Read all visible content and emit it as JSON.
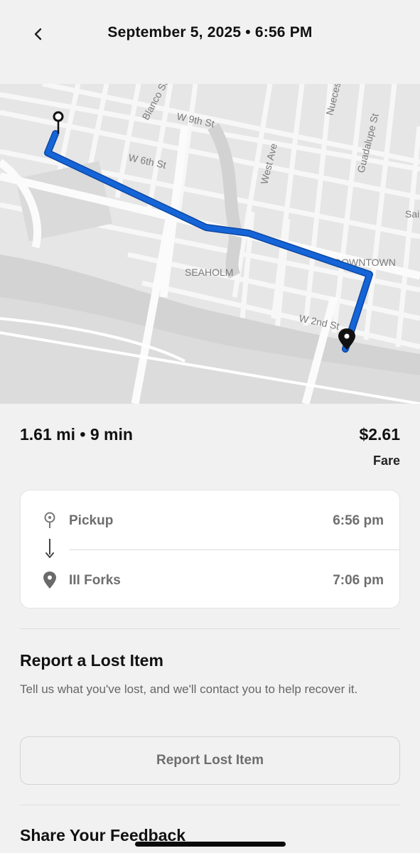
{
  "header": {
    "title": "September 5, 2025 • 6:56 PM",
    "back_icon": "chevron-left-icon"
  },
  "map": {
    "labels": {
      "blanco": "Blanco St",
      "w9th": "W 9th St",
      "nueces": "Nueces",
      "guadalupe": "Guadalupe St",
      "w6th": "W 6th St",
      "west_ave": "West Ave",
      "sai": "Sai",
      "downtown": "DOWNTOWN",
      "seaholm": "SEAHOLM",
      "w2nd": "W 2nd St"
    },
    "route_color": "#1565d8",
    "pin_color": "#111111"
  },
  "summary": {
    "stats": "1.61 mi • 9 min",
    "fare_amount": "$2.61",
    "fare_label": "Fare"
  },
  "route": {
    "pickup": {
      "name": "Pickup",
      "time": "6:56 pm",
      "icon": "pickup-pin-icon"
    },
    "dropoff": {
      "name": "III Forks",
      "time": "7:06 pm",
      "icon": "location-pin-icon"
    }
  },
  "lost_item": {
    "title": "Report a Lost Item",
    "description": "Tell us what you've lost, and we'll contact you to help recover it.",
    "button_label": "Report Lost Item"
  },
  "feedback": {
    "title": "Share Your Feedback"
  }
}
